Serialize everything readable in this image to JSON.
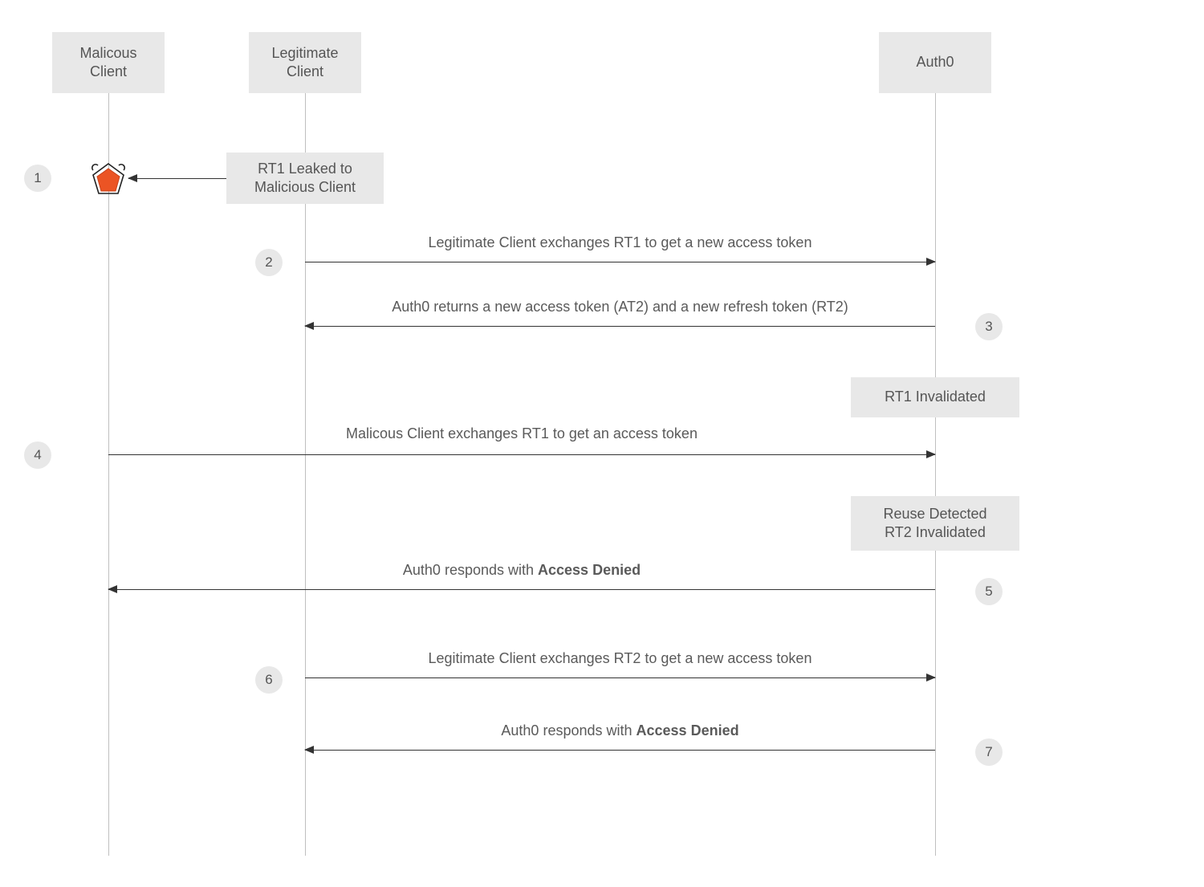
{
  "participants": {
    "malicious": "Malicous\nClient",
    "legitimate": "Legitimate\nClient",
    "auth0": "Auth0"
  },
  "notes": {
    "leak": "RT1 Leaked to\nMalicious Client",
    "invalidated": "RT1 Invalidated",
    "reuse": "Reuse Detected\nRT2 Invalidated"
  },
  "messages": {
    "m2": "Legitimate Client exchanges RT1 to get a new access token",
    "m3": "Auth0 returns a new access token (AT2) and a new refresh token (RT2)",
    "m4": "Malicous Client exchanges RT1 to get an access token",
    "m5_pre": "Auth0 responds with ",
    "m5_bold": "Access Denied",
    "m6": "Legitimate Client exchanges RT2 to get a new access token",
    "m7_pre": "Auth0 responds with ",
    "m7_bold": "Access Denied"
  },
  "steps": {
    "s1": "1",
    "s2": "2",
    "s3": "3",
    "s4": "4",
    "s5": "5",
    "s6": "6",
    "s7": "7"
  },
  "icons": {
    "malicious_badge": "malicious-badge-icon"
  }
}
